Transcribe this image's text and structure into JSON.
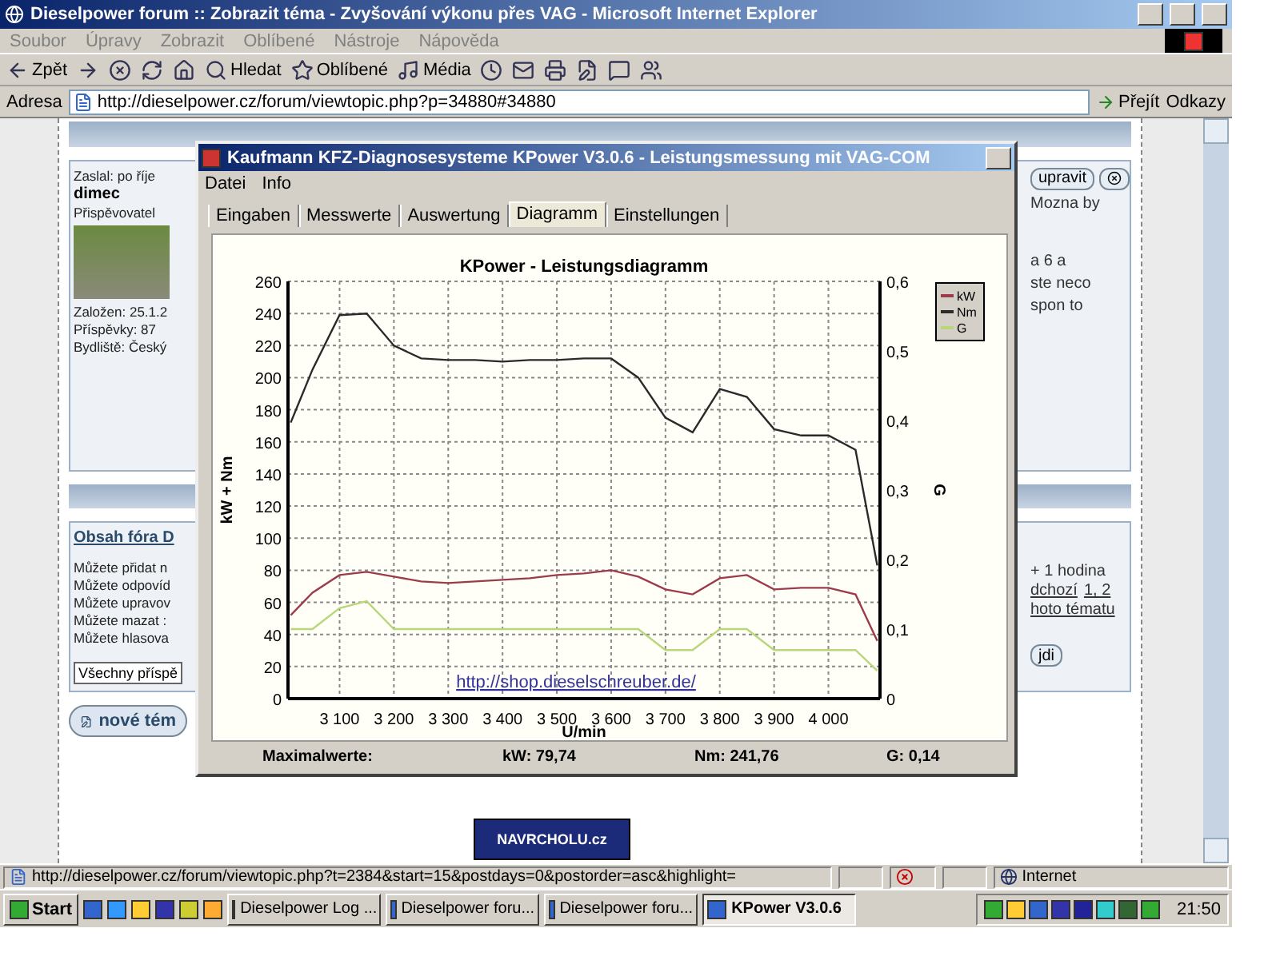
{
  "window": {
    "title": "Dieselpower forum :: Zobrazit téma - Zvyšování výkonu přes VAG - Microsoft Internet Explorer"
  },
  "menu": [
    "Soubor",
    "Úpravy",
    "Zobrazit",
    "Oblíbené",
    "Nástroje",
    "Nápověda"
  ],
  "toolbar": [
    {
      "kind": "back",
      "label": "Zpět"
    },
    {
      "kind": "forward"
    },
    {
      "kind": "stop"
    },
    {
      "kind": "refresh"
    },
    {
      "kind": "home"
    },
    {
      "kind": "search",
      "label": "Hledat"
    },
    {
      "kind": "favorites",
      "label": "Oblíbené"
    },
    {
      "kind": "media",
      "label": "Média"
    },
    {
      "kind": "history"
    },
    {
      "kind": "mail"
    },
    {
      "kind": "print"
    },
    {
      "kind": "edit"
    },
    {
      "kind": "discuss"
    },
    {
      "kind": "messenger"
    }
  ],
  "address": {
    "label": "Adresa",
    "url": "http://dieselpower.cz/forum/viewtopic.php?p=34880#34880",
    "go": "Přejít",
    "links": "Odkazy"
  },
  "forum": {
    "post": {
      "header": "Zaslal: po říje",
      "author": "dimec",
      "rank": "Přispěvovatel",
      "details": [
        "Založen: 25.1.2",
        "Příspěvky: 87",
        "Bydliště: Český"
      ],
      "edit": "upravit",
      "body": [
        "Mozna by",
        "a 6 a",
        "ste neco",
        "spon to"
      ]
    },
    "info": {
      "title": "Obsah fóra D",
      "permissions": [
        "Můžete přidat n",
        "Můžete odpovíd",
        "Můžete upravov",
        "Můžete mazat :",
        "Můžete hlasova"
      ],
      "timezone": "+ 1 hodina",
      "prev": "dchozí",
      "pages": "1, 2",
      "watch": "hoto tématu",
      "sort": "Všechny příspě",
      "go": "jdi",
      "new_topic": "nové tém"
    }
  },
  "dialog": {
    "title": "Kaufmann KFZ-Diagnosesysteme  KPower V3.0.6 - Leistungsmessung mit VAG-COM",
    "menu": [
      "Datei",
      "Info"
    ],
    "tabs": [
      {
        "label": "Eingaben",
        "selected": false
      },
      {
        "label": "Messwerte",
        "selected": false
      },
      {
        "label": "Auswertung",
        "selected": false
      },
      {
        "label": "Diagramm",
        "selected": true
      },
      {
        "label": "Einstellungen",
        "selected": false
      }
    ],
    "chart_data": {
      "type": "line",
      "title": "KPower - Leistungsdiagramm",
      "xlabel": "U/min",
      "ylabel": "kW + Nm",
      "y2label": "G",
      "x": [
        3010,
        3050,
        3100,
        3150,
        3200,
        3250,
        3300,
        3350,
        3400,
        3450,
        3500,
        3550,
        3600,
        3650,
        3700,
        3750,
        3800,
        3850,
        3900,
        3950,
        4000,
        4050,
        4090
      ],
      "series": [
        {
          "name": "kW",
          "color": "#9c3c4a",
          "values": [
            52,
            66,
            77,
            79,
            76,
            73,
            72,
            73,
            74,
            75,
            77,
            78,
            80,
            76,
            68,
            65,
            75,
            77,
            68,
            69,
            69,
            65,
            36
          ]
        },
        {
          "name": "Nm",
          "color": "#2a2a2a",
          "values": [
            172,
            205,
            239,
            240,
            220,
            212,
            211,
            211,
            210,
            211,
            211,
            212,
            212,
            200,
            175,
            166,
            193,
            188,
            168,
            164,
            164,
            155,
            83
          ]
        },
        {
          "name": "G",
          "color": "#b9d67a",
          "axis": "y2",
          "values": [
            0.1,
            0.1,
            0.13,
            0.14,
            0.1,
            0.1,
            0.1,
            0.1,
            0.1,
            0.1,
            0.1,
            0.1,
            0.1,
            0.1,
            0.07,
            0.07,
            0.1,
            0.1,
            0.07,
            0.07,
            0.07,
            0.07,
            0.04
          ]
        }
      ],
      "grid": true,
      "legend": "right",
      "xlim": [
        3005,
        4095
      ],
      "ylim": [
        0,
        260
      ],
      "y2lim": [
        0,
        0.6
      ],
      "xticks": [
        {
          "value": 3100,
          "label": "3 100"
        },
        {
          "value": 3200,
          "label": "3 200"
        },
        {
          "value": 3300,
          "label": "3 300"
        },
        {
          "value": 3400,
          "label": "3 400"
        },
        {
          "value": 3500,
          "label": "3 500"
        },
        {
          "value": 3600,
          "label": "3 600"
        },
        {
          "value": 3700,
          "label": "3 700"
        },
        {
          "value": 3800,
          "label": "3 800"
        },
        {
          "value": 3900,
          "label": "3 900"
        },
        {
          "value": 4000,
          "label": "4 000"
        }
      ],
      "yticks": [
        0,
        20,
        40,
        60,
        80,
        100,
        120,
        140,
        160,
        180,
        200,
        220,
        240,
        260
      ],
      "y2ticks": [
        {
          "value": 0,
          "label": "0"
        },
        {
          "value": 0.1,
          "label": "0,1"
        },
        {
          "value": 0.2,
          "label": "0,2"
        },
        {
          "value": 0.3,
          "label": "0,3"
        },
        {
          "value": 0.4,
          "label": "0,4"
        },
        {
          "value": 0.5,
          "label": "0,5"
        },
        {
          "value": 0.6,
          "label": "0,6"
        }
      ],
      "annotations": [
        {
          "text": "http://shop.dieselschreuber.de/"
        }
      ]
    },
    "maxima": {
      "label": "Maximalwerte:",
      "values": [
        "kW: 79,74",
        "Nm: 241,76",
        "G: 0,14"
      ]
    }
  },
  "banner": "NAVRCHOLU.cz",
  "status_bar": {
    "url": "http://dieselpower.cz/forum/viewtopic.php?t=2384&start=15&postdays=0&postorder=asc&highlight=",
    "zone": "Internet"
  },
  "taskbar": {
    "start": "Start",
    "tasks": [
      {
        "label": "Dieselpower Log ...",
        "selected": false
      },
      {
        "label": "Dieselpower foru...",
        "selected": false
      },
      {
        "label": "Dieselpower foru...",
        "selected": false
      },
      {
        "label": "KPower V3.0.6",
        "selected": true
      }
    ],
    "clock": "21:50"
  }
}
